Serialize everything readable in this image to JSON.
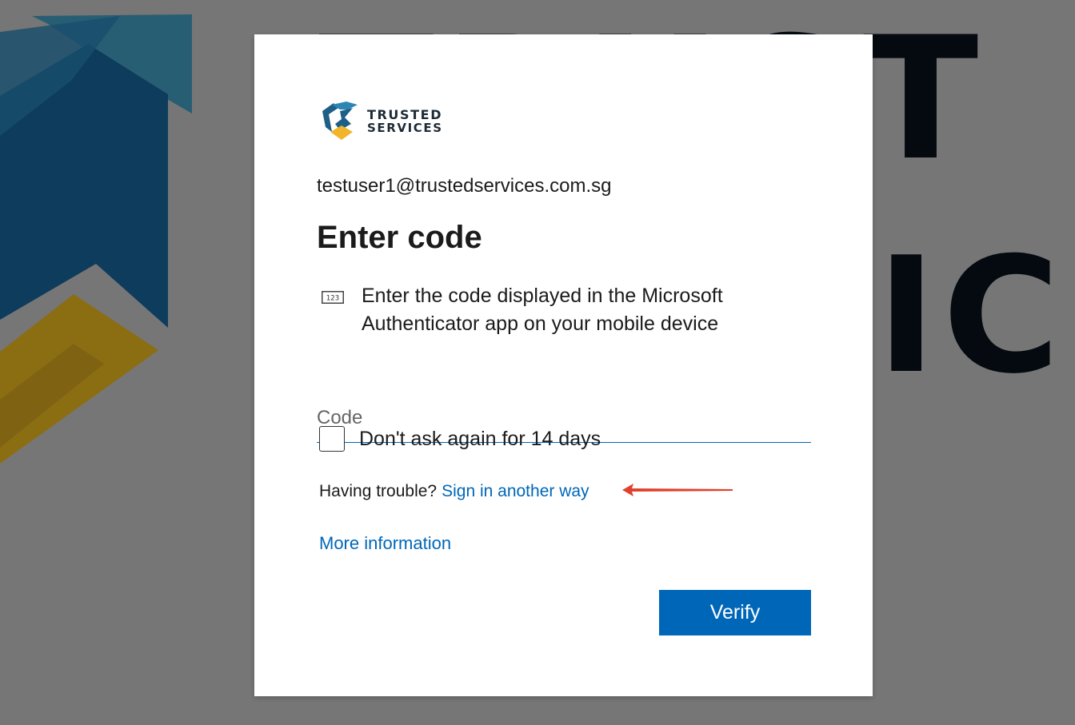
{
  "background": {
    "big_text_row1": "TRUST",
    "big_text_row2": "ICE"
  },
  "logo": {
    "line1": "TRUSTED",
    "line2": "SERVICES"
  },
  "account": {
    "email": "testuser1@trustedservices.com.sg"
  },
  "page": {
    "title": "Enter code",
    "description": "Enter the code displayed in the Microsoft Authenticator app on your mobile device",
    "code_icon_label": "123"
  },
  "code_field": {
    "placeholder": "Code",
    "value": ""
  },
  "remember": {
    "label": "Don't ask again for 14 days",
    "checked": false
  },
  "trouble": {
    "prefix": "Having trouble?",
    "link": "Sign in another way"
  },
  "more_info": {
    "label": "More information"
  },
  "actions": {
    "verify_label": "Verify"
  },
  "colors": {
    "accent": "#0067b8",
    "background": "#767676",
    "annotation_arrow": "#e0412c"
  }
}
